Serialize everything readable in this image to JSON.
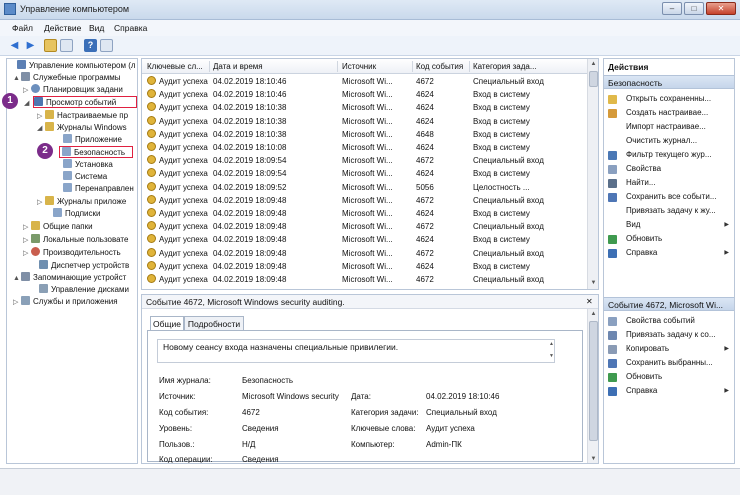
{
  "window": {
    "title": "Управление компьютером",
    "btn_min": "–",
    "btn_max": "□",
    "btn_close": "✕"
  },
  "menu": [
    "Файл",
    "Действие",
    "Вид",
    "Справка"
  ],
  "toolbar_icons": [
    "back-arrow-icon",
    "forward-arrow-icon",
    "up-folder-icon",
    "show-hide-tree-icon",
    "help-icon",
    "properties-icon"
  ],
  "tree": {
    "items": [
      {
        "label": "Управление компьютером (л",
        "twisty": "",
        "icon_color": "#5b7fb4"
      },
      {
        "label": "Служебные программы",
        "twisty": "▲",
        "icon_color": "#7f8fa6"
      },
      {
        "label": "Планировщик задани",
        "twisty": "▷",
        "icon_color": "#6c8fbd"
      },
      {
        "label": "Просмотр событий",
        "twisty": "◢",
        "icon_color": "#4f76b0"
      },
      {
        "label": "Настраиваемые пр",
        "twisty": "▷",
        "icon_color": "#d8b44a"
      },
      {
        "label": "Журналы Windows",
        "twisty": "◢",
        "icon_color": "#d8b44a"
      },
      {
        "label": "Приложение",
        "twisty": "",
        "icon_color": "#8aa5c9"
      },
      {
        "label": "Безопасность",
        "twisty": "",
        "icon_color": "#8aa5c9"
      },
      {
        "label": "Установка",
        "twisty": "",
        "icon_color": "#8aa5c9"
      },
      {
        "label": "Система",
        "twisty": "",
        "icon_color": "#8aa5c9"
      },
      {
        "label": "Перенаправлен",
        "twisty": "",
        "icon_color": "#8aa5c9"
      },
      {
        "label": "Журналы приложе",
        "twisty": "▷",
        "icon_color": "#d8b44a"
      },
      {
        "label": "Подписки",
        "twisty": "",
        "icon_color": "#8aa5c9"
      },
      {
        "label": "Общие папки",
        "twisty": "▷",
        "icon_color": "#d8b44a"
      },
      {
        "label": "Локальные пользовате",
        "twisty": "▷",
        "icon_color": "#7a9a6a"
      },
      {
        "label": "Производительность",
        "twisty": "▷",
        "icon_color": "#c95e4e"
      },
      {
        "label": "Диспетчер устройств",
        "twisty": "",
        "icon_color": "#6f8fb0"
      },
      {
        "label": "Запоминающие устройст",
        "twisty": "▲",
        "icon_color": "#7f8fa6"
      },
      {
        "label": "Управление дисками",
        "twisty": "",
        "icon_color": "#8a9fb5"
      },
      {
        "label": "Службы и приложения",
        "twisty": "▷",
        "icon_color": "#8aa0b8"
      }
    ]
  },
  "markers": {
    "one": "1",
    "two": "2"
  },
  "grid": {
    "columns": [
      "Ключевые сл...",
      "Дата и время",
      "Источник",
      "Код события",
      "Категория зада..."
    ],
    "rows": [
      [
        "Аудит успеха",
        "04.02.2019 18:10:46",
        "Microsoft Wi...",
        "4672",
        "Специальный вход"
      ],
      [
        "Аудит успеха",
        "04.02.2019 18:10:46",
        "Microsoft Wi...",
        "4624",
        "Вход в систему"
      ],
      [
        "Аудит успеха",
        "04.02.2019 18:10:38",
        "Microsoft Wi...",
        "4624",
        "Вход в систему"
      ],
      [
        "Аудит успеха",
        "04.02.2019 18:10:38",
        "Microsoft Wi...",
        "4624",
        "Вход в систему"
      ],
      [
        "Аудит успеха",
        "04.02.2019 18:10:38",
        "Microsoft Wi...",
        "4648",
        "Вход в систему"
      ],
      [
        "Аудит успеха",
        "04.02.2019 18:10:08",
        "Microsoft Wi...",
        "4624",
        "Вход в систему"
      ],
      [
        "Аудит успеха",
        "04.02.2019 18:09:54",
        "Microsoft Wi...",
        "4672",
        "Специальный вход"
      ],
      [
        "Аудит успеха",
        "04.02.2019 18:09:54",
        "Microsoft Wi...",
        "4624",
        "Вход в систему"
      ],
      [
        "Аудит успеха",
        "04.02.2019 18:09:52",
        "Microsoft Wi...",
        "5056",
        "Целостность ..."
      ],
      [
        "Аудит успеха",
        "04.02.2019 18:09:48",
        "Microsoft Wi...",
        "4672",
        "Специальный вход"
      ],
      [
        "Аудит успеха",
        "04.02.2019 18:09:48",
        "Microsoft Wi...",
        "4624",
        "Вход в систему"
      ],
      [
        "Аудит успеха",
        "04.02.2019 18:09:48",
        "Microsoft Wi...",
        "4672",
        "Специальный вход"
      ],
      [
        "Аудит успеха",
        "04.02.2019 18:09:48",
        "Microsoft Wi...",
        "4624",
        "Вход в систему"
      ],
      [
        "Аудит успеха",
        "04.02.2019 18:09:48",
        "Microsoft Wi...",
        "4672",
        "Специальный вход"
      ],
      [
        "Аудит успеха",
        "04.02.2019 18:09:48",
        "Microsoft Wi...",
        "4624",
        "Вход в систему"
      ],
      [
        "Аудит успеха",
        "04.02.2019 18:09:48",
        "Microsoft Wi...",
        "4672",
        "Специальный вход"
      ]
    ]
  },
  "detail": {
    "title": "Событие 4672, Microsoft Windows security auditing.",
    "close": "✕",
    "tabs": [
      "Общие",
      "Подробности"
    ],
    "message": "Новому сеансу входа назначены специальные привилегии.",
    "labels": {
      "log_name": "Имя журнала:",
      "source": "Источник:",
      "event_id": "Код события:",
      "level": "Уровень:",
      "user": "Пользов.:",
      "opcode": "Код операции:",
      "date": "Дата:",
      "task_category": "Категория задачи:",
      "keywords": "Ключевые слова:",
      "computer": "Компьютер:"
    },
    "values": {
      "log_name": "Безопасность",
      "source": "Microsoft Windows security",
      "event_id": "4672",
      "level": "Сведения",
      "user": "Н/Д",
      "opcode": "Сведения",
      "date": "04.02.2019 18:10:46",
      "task_category": "Специальный вход",
      "keywords": "Аудит успеха",
      "computer": "Admin-ПК"
    }
  },
  "actions": {
    "header": "Действия",
    "section1": "Безопасность",
    "items1": [
      {
        "label": "Открыть сохраненны...",
        "icon_color": "#e0b94a",
        "submenu": false
      },
      {
        "label": "Создать настраивае...",
        "icon_color": "#d59a3a",
        "submenu": false
      },
      {
        "label": "Импорт настраивае...",
        "icon_color": "#ffffff",
        "submenu": false
      },
      {
        "label": "Очистить журнал...",
        "icon_color": "#ffffff",
        "submenu": false
      },
      {
        "label": "Фильтр текущего жур...",
        "icon_color": "#4a78b5",
        "submenu": false
      },
      {
        "label": "Свойства",
        "icon_color": "#8aa0c0",
        "submenu": false
      },
      {
        "label": "Найти...",
        "icon_color": "#5a6f8a",
        "submenu": false
      },
      {
        "label": "Сохранить все событи...",
        "icon_color": "#4e76b5",
        "submenu": false
      },
      {
        "label": "Привязать задачу к жу...",
        "icon_color": "#ffffff",
        "submenu": false
      },
      {
        "label": "Вид",
        "icon_color": "#ffffff",
        "submenu": true
      },
      {
        "label": "Обновить",
        "icon_color": "#3f9a4f",
        "submenu": false
      },
      {
        "label": "Справка",
        "icon_color": "#3d6fb4",
        "submenu": true
      }
    ],
    "section2": "Событие 4672, Microsoft Wi...",
    "items2": [
      {
        "label": "Свойства событий",
        "icon_color": "#8aa0c0",
        "submenu": false
      },
      {
        "label": "Привязать задачу к со...",
        "icon_color": "#6d87b0",
        "submenu": false
      },
      {
        "label": "Копировать",
        "icon_color": "#8a9bb5",
        "submenu": true
      },
      {
        "label": "Сохранить выбранны...",
        "icon_color": "#4e76b5",
        "submenu": false
      },
      {
        "label": "Обновить",
        "icon_color": "#3f9a4f",
        "submenu": false
      },
      {
        "label": "Справка",
        "icon_color": "#3d6fb4",
        "submenu": true
      }
    ]
  },
  "colors": {
    "highlight_red": "#e02040",
    "marker_purple": "#7b2c8a"
  }
}
